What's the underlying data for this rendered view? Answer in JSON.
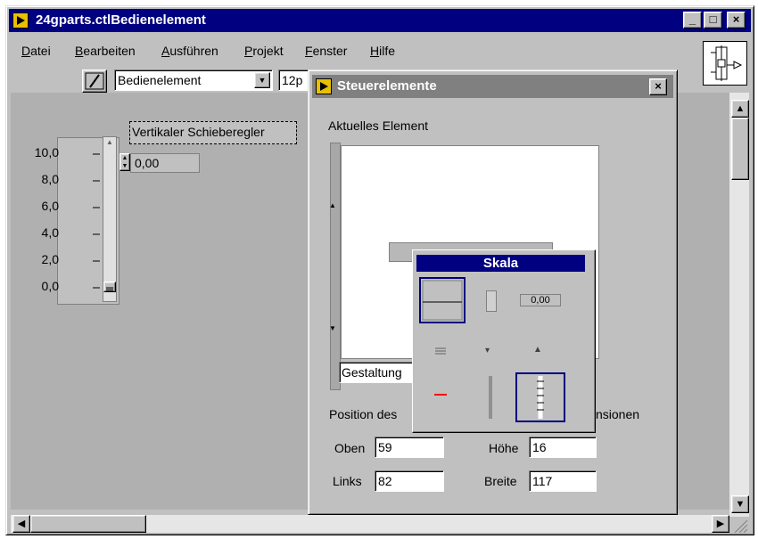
{
  "window": {
    "title": "24gparts.ctlBedienelement",
    "minimize": "_",
    "maximize": "□",
    "close": "×"
  },
  "menu": [
    {
      "pre": "",
      "u": "D",
      "post": "atei"
    },
    {
      "pre": "",
      "u": "B",
      "post": "earbeiten"
    },
    {
      "pre": "",
      "u": "A",
      "post": "usführen"
    },
    {
      "pre": "",
      "u": "P",
      "post": "rojekt"
    },
    {
      "pre": "",
      "u": "F",
      "post": "enster"
    },
    {
      "pre": "",
      "u": "H",
      "post": "ilfe"
    }
  ],
  "toolbar": {
    "mode_select": "Bedienelement",
    "font_select": "12p"
  },
  "slider": {
    "caption": "Vertikaler Schieberegler",
    "ticks": [
      "10,0",
      "8,0",
      "6,0",
      "4,0",
      "2,0",
      "0,0"
    ],
    "digital_value": "0,00",
    "value": 0
  },
  "dialog": {
    "title": "Steuerelemente",
    "current_label": "Aktuelles Element",
    "gestaltung": "Gestaltung",
    "position_label": "Position des",
    "dimensions_label": "nsionen",
    "oben_label": "Oben",
    "oben_value": "59",
    "links_label": "Links",
    "links_value": "82",
    "hoehe_label": "Höhe",
    "hoehe_value": "16",
    "breite_label": "Breite",
    "breite_value": "117"
  },
  "palette": {
    "title": "Skala",
    "digital_preview": "0,00"
  },
  "colors": {
    "titlebar_active": "#000080",
    "titlebar_inactive": "#808080",
    "window_bg": "#c0c0c0",
    "canvas_bg": "#b0b0b0",
    "icon_yellow": "#e8c000",
    "marker_red": "#ff0000"
  }
}
